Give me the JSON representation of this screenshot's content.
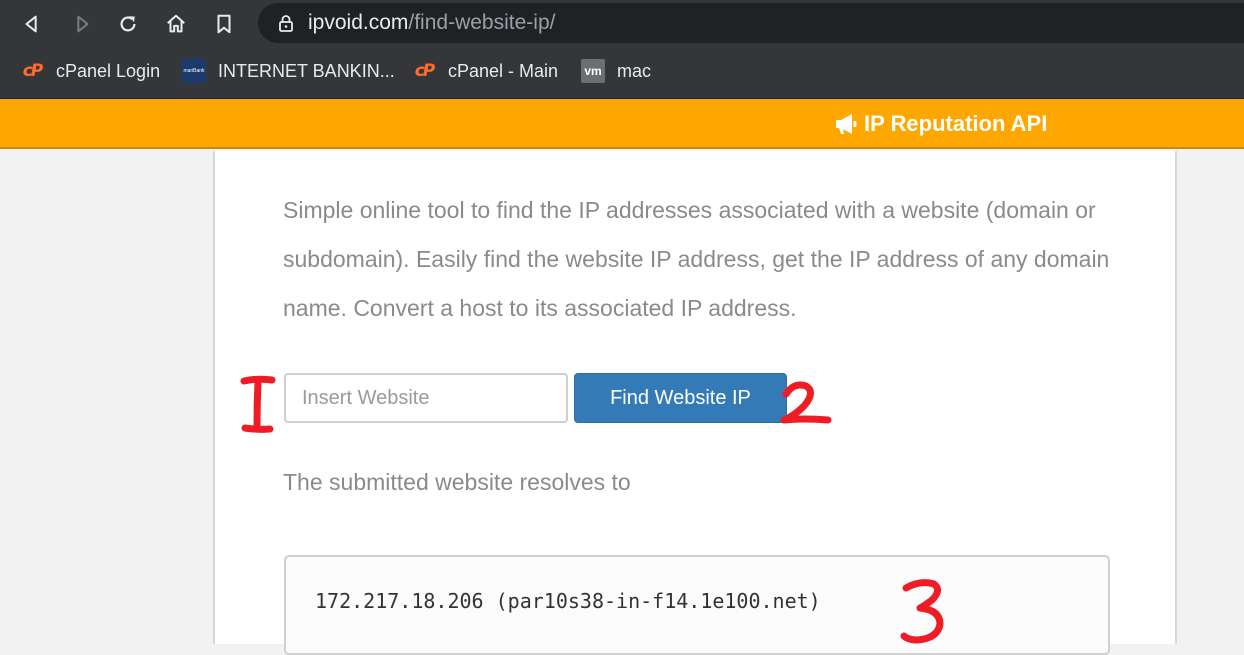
{
  "browser": {
    "url_host": "ipvoid.com",
    "url_path": "/find-website-ip/",
    "nav_icons": [
      "back-icon",
      "forward-icon",
      "reload-icon",
      "home-icon",
      "bookmark-icon"
    ],
    "bookmarks": [
      {
        "label": "cPanel Login",
        "icon": "cpanel-icon",
        "favicon_text": "cP"
      },
      {
        "label": "INTERNET BANKIN...",
        "icon": "bank-icon",
        "favicon_text": "mariBank"
      },
      {
        "label": "cPanel - Main",
        "icon": "cpanel-icon",
        "favicon_text": "cP"
      },
      {
        "label": "mac",
        "icon": "vm-icon",
        "favicon_text": "vm"
      }
    ]
  },
  "header": {
    "api_label": "IP Reputation API",
    "api_icon": "megaphone-icon",
    "bar_color": "#fda700"
  },
  "main": {
    "description": "Simple online tool to find the IP addresses associated with a website (domain or subdomain). Easily find the website IP address, get the IP address of any domain name. Convert a host to its associated IP address.",
    "input_placeholder": "Insert Website",
    "input_value": "",
    "button_label": "Find Website IP",
    "button_color": "#337ab7",
    "resolves_label": "The submitted website resolves to",
    "result": "172.217.18.206 (par10s38-in-f14.1e100.net)"
  },
  "annotations": [
    "I",
    "2",
    "3"
  ]
}
